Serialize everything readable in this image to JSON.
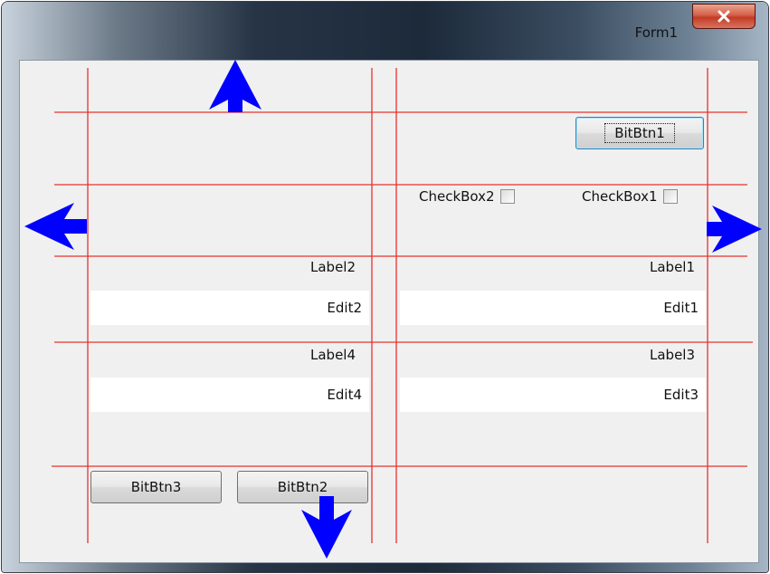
{
  "window": {
    "title": "Form1"
  },
  "labels": {
    "label1": "Label1",
    "label2": "Label2",
    "label3": "Label3",
    "label4": "Label4"
  },
  "edits": {
    "edit1": "Edit1",
    "edit2": "Edit2",
    "edit3": "Edit3",
    "edit4": "Edit4"
  },
  "buttons": {
    "bitbtn1": "BitBtn1",
    "bitbtn2": "BitBtn2",
    "bitbtn3": "BitBtn3"
  },
  "checkboxes": {
    "checkbox1": "CheckBox1",
    "checkbox2": "CheckBox2"
  },
  "colors": {
    "guide_line": "#e8322d",
    "arrow": "#0000ff",
    "client_bg": "#f0f0f0"
  },
  "icons": {
    "close": "close-icon",
    "arrows": [
      "arrow-up-icon",
      "arrow-left-icon",
      "arrow-right-icon",
      "arrow-down-icon"
    ]
  }
}
